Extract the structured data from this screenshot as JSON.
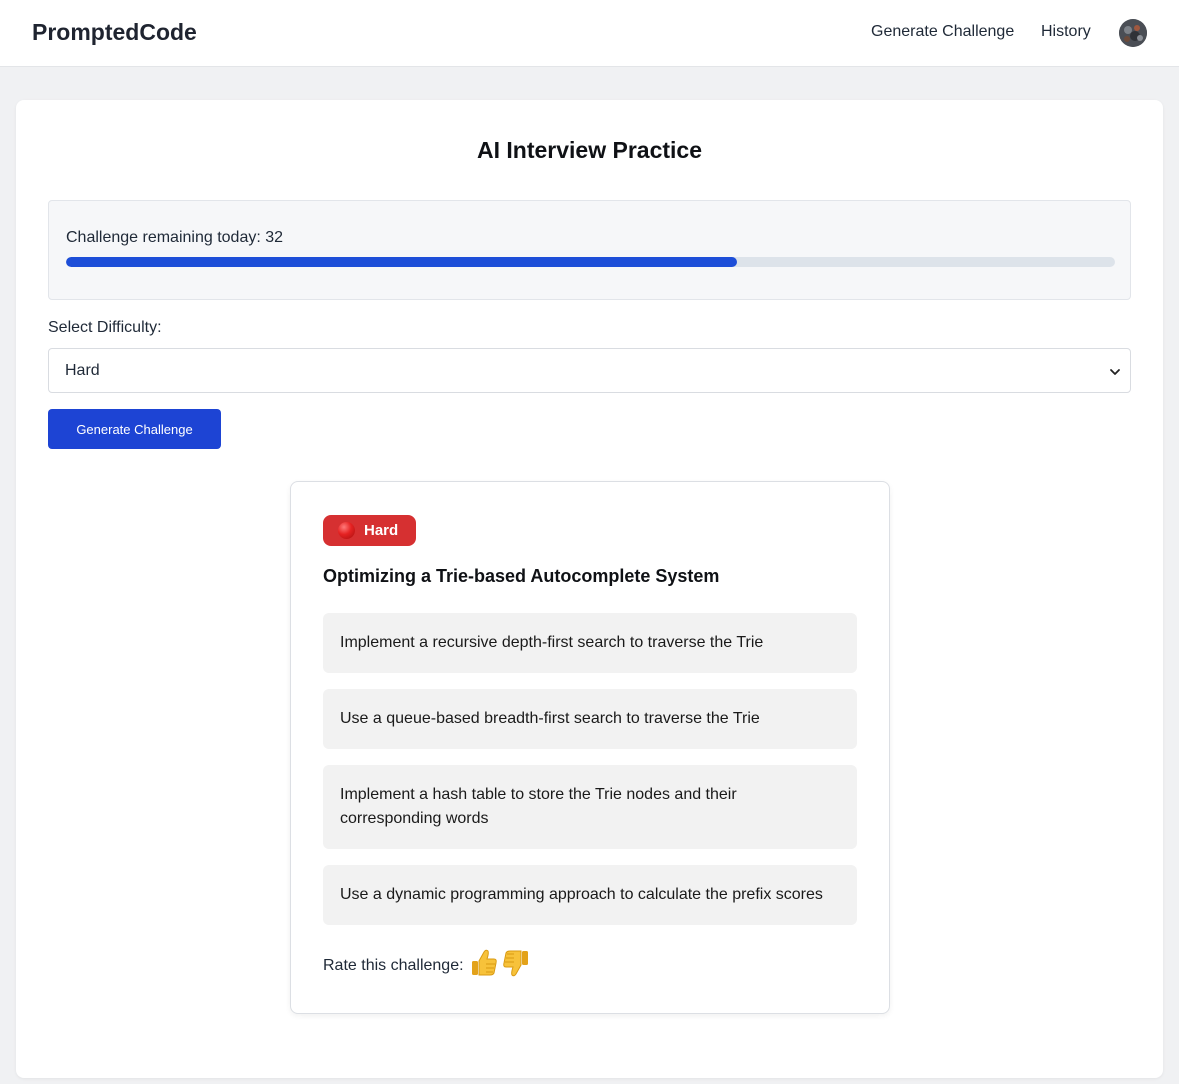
{
  "nav": {
    "brand": "PromptedCode",
    "links": [
      "Generate Challenge",
      "History"
    ]
  },
  "page": {
    "title": "AI Interview Practice"
  },
  "quota": {
    "text": "Challenge remaining today: 32",
    "progress_fraction": 0.64,
    "progress_color": "#1d4ed8"
  },
  "difficulty": {
    "label": "Select Difficulty:",
    "selected": "Hard"
  },
  "generate_button": "Generate Challenge",
  "challenge": {
    "badge": "Hard",
    "badge_color": "#d63031",
    "title": "Optimizing a Trie-based Autocomplete System",
    "options": [
      "Implement a recursive depth-first search to traverse the Trie",
      "Use a queue-based breadth-first search to traverse the Trie",
      "Implement a hash table to store the Trie nodes and their corresponding words",
      "Use a dynamic programming approach to calculate the prefix scores"
    ],
    "rate_label": "Rate this challenge:"
  },
  "icons": [
    "avatar",
    "red-circle-icon",
    "chevron-down-icon",
    "thumbs-up-icon",
    "thumbs-down-icon"
  ]
}
